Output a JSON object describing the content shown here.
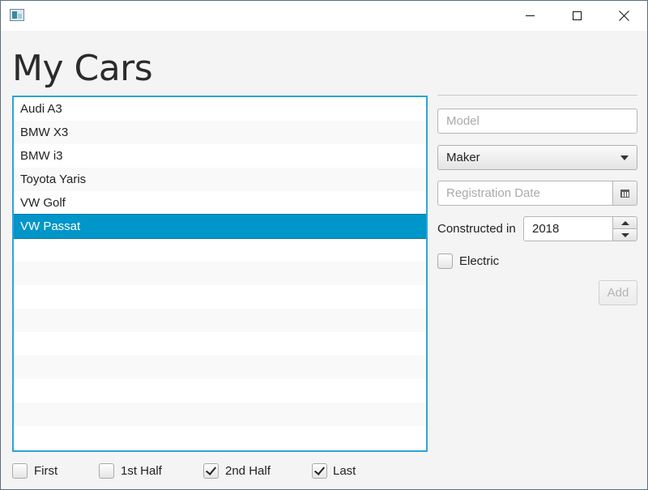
{
  "window": {
    "title": ""
  },
  "page": {
    "title": "My Cars"
  },
  "car_list": {
    "items": [
      "Audi A3",
      "BMW X3",
      "BMW i3",
      "Toyota Yaris",
      "VW Golf",
      "VW Passat"
    ],
    "selected": "VW Passat"
  },
  "form": {
    "model_placeholder": "Model",
    "maker_value": "Maker",
    "registration_placeholder": "Registration Date",
    "constructed_label": "Constructed in",
    "year_value": "2018",
    "electric_label": "Electric",
    "electric_checked": false,
    "add_label": "Add",
    "add_enabled": false
  },
  "filters": [
    {
      "label": "First",
      "checked": false
    },
    {
      "label": "1st Half",
      "checked": false
    },
    {
      "label": "2nd Half",
      "checked": true
    },
    {
      "label": "Last",
      "checked": true
    }
  ],
  "colors": {
    "selection": "#0096c9",
    "focus_border": "#2ea3d8"
  },
  "icons": {
    "app": "app-icon",
    "calendar": "calendar-icon",
    "dropdown": "chevron-down-icon"
  }
}
